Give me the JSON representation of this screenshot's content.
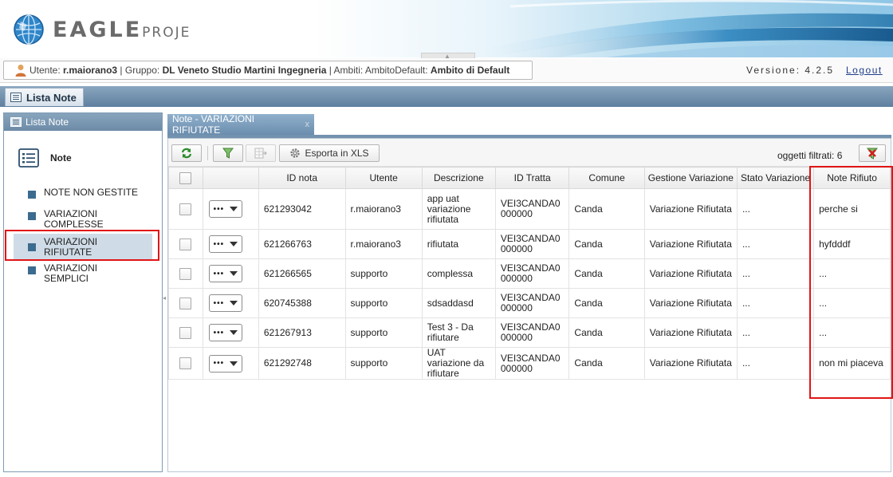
{
  "app": {
    "logo_text": "EAGLE",
    "logo_suffix": "PROJE"
  },
  "userbar": {
    "utente_label": "Utente:",
    "utente": "r.maiorano3",
    "gruppo_label": "| Gruppo:",
    "gruppo": "DL Veneto Studio Martini Ingegneria",
    "ambiti_label": "| Ambiti: AmbitoDefault:",
    "ambito": "Ambito di Default",
    "version": "Versione:  4.2.5",
    "logout": "Logout"
  },
  "titlebar": {
    "title": "Lista Note"
  },
  "left_panel": {
    "header": "Lista Note",
    "section": "Note",
    "items": [
      {
        "label": "NOTE NON GESTITE",
        "selected": false
      },
      {
        "label": "VARIAZIONI COMPLESSE",
        "selected": false
      },
      {
        "label": "VARIAZIONI RIFIUTATE",
        "selected": true
      },
      {
        "label": "VARIAZIONI SEMPLICI",
        "selected": false
      }
    ]
  },
  "main": {
    "tab_label": "Note - VARIAZIONI RIFIUTATE",
    "tab_close": "x",
    "toolbar": {
      "export_label": "Esporta in XLS",
      "filter_count": "oggetti filtrati: 6"
    },
    "columns": [
      "ID nota",
      "Utente",
      "Descrizione",
      "ID Tratta",
      "Comune",
      "Gestione Variazione",
      "Stato Variazione",
      "Note Rifiuto"
    ],
    "rows": [
      {
        "id": "621293042",
        "utente": "r.maiorano3",
        "descrizione": "app uat variazione rifiutata",
        "tratta": "VEI3CANDA0000000",
        "comune": "Canda",
        "gestione": "Variazione Rifiutata",
        "stato": "...",
        "note": "perche si"
      },
      {
        "id": "621266763",
        "utente": "r.maiorano3",
        "descrizione": "rifiutata",
        "tratta": "VEI3CANDA0000000",
        "comune": "Canda",
        "gestione": "Variazione Rifiutata",
        "stato": "...",
        "note": "hyfdddf"
      },
      {
        "id": "621266565",
        "utente": "supporto",
        "descrizione": "complessa",
        "tratta": "VEI3CANDA0000000",
        "comune": "Canda",
        "gestione": "Variazione Rifiutata",
        "stato": "...",
        "note": "..."
      },
      {
        "id": "620745388",
        "utente": "supporto",
        "descrizione": "sdsaddasd",
        "tratta": "VEI3CANDA0000000",
        "comune": "Canda",
        "gestione": "Variazione Rifiutata",
        "stato": "...",
        "note": "..."
      },
      {
        "id": "621267913",
        "utente": "supporto",
        "descrizione": "Test 3 - Da rifiutare",
        "tratta": "VEI3CANDA0000000",
        "comune": "Canda",
        "gestione": "Variazione Rifiutata",
        "stato": "...",
        "note": "..."
      },
      {
        "id": "621292748",
        "utente": "supporto",
        "descrizione": "UAT variazione da rifiutare",
        "tratta": "VEI3CANDA0000000",
        "comune": "Canda",
        "gestione": "Variazione Rifiutata",
        "stato": "...",
        "note": "non mi piaceva"
      }
    ],
    "row_action_symbol": "•••"
  },
  "colors": {
    "highlight_border": "#e01515",
    "panel_header": "#6d8ba7",
    "nav_square": "#3b6b8e",
    "logout_link": "#1f3e8a"
  },
  "icons": [
    "globe-logo-icon",
    "user-icon",
    "list-icon",
    "note-list-icon",
    "refresh-icon",
    "filter-icon",
    "export-grid-icon",
    "gear-icon",
    "clear-filter-icon",
    "caret-down-icon"
  ]
}
